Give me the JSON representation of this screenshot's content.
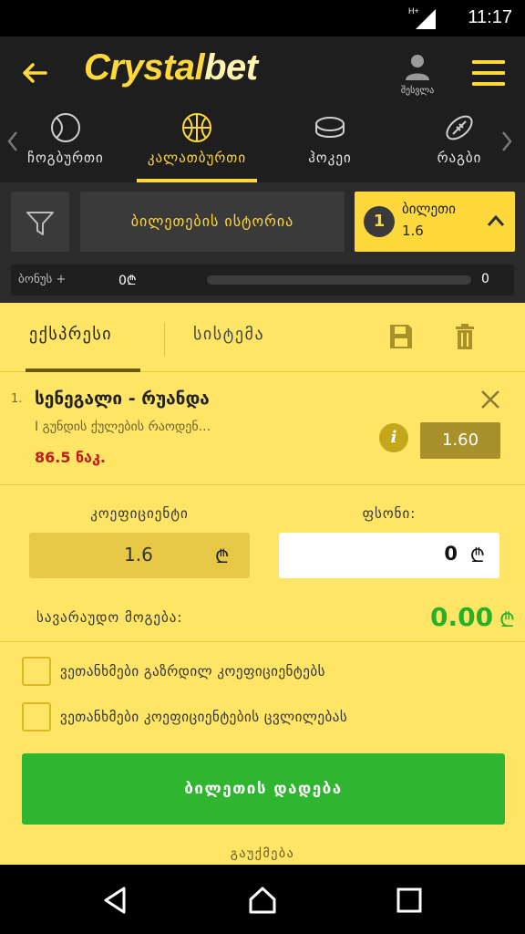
{
  "status": {
    "time": "11:17",
    "network": "H+"
  },
  "header": {
    "logo_main": "Crystal",
    "logo_accent": "bet",
    "user_label": "შესვლა"
  },
  "sports": [
    {
      "label": "ჩოგბურთი",
      "icon": "tennis-ball-icon"
    },
    {
      "label": "კალათბურთი",
      "icon": "basketball-icon",
      "active": true
    },
    {
      "label": "ჰოკეი",
      "icon": "hockey-puck-icon"
    },
    {
      "label": "რაგბი",
      "icon": "rugby-ball-icon"
    }
  ],
  "controls": {
    "history_label": "ბილეთების ისტორია",
    "ticket_count": "1",
    "ticket_label": "ბილეთი",
    "ticket_odds": "1.6"
  },
  "bonus": {
    "label": "ბონუს +",
    "current": "0₾",
    "max": "0",
    "progress": 0
  },
  "betslip": {
    "tabs": {
      "express": "ექსპრესი",
      "system": "სისტემა"
    },
    "selection": {
      "index": "1.",
      "match": "სენეგალი - რუანდა",
      "market": "I გუნდის ქულების რაოდენ...",
      "line": "86.5 ნაკ.",
      "odds": "1.60"
    },
    "coef_label": "კოეფიციენტი",
    "coef_value": "1.6",
    "stake_label": "ფსონი:",
    "stake_value": "0",
    "currency": "₾",
    "win_label": "სავარაუდო მოგება:",
    "win_value": "0.00",
    "check_increase": "ვეთანხმები გაზრდილ კოეფიციენტებს",
    "check_change": "ვეთანხმები კოეფიციენტების ცვლილებას",
    "place_label": "ბილეთის დადება",
    "cancel_label": "გაუქმება"
  },
  "colors": {
    "accent": "#ffd93b",
    "panel": "#ffe566",
    "win": "#27b027",
    "danger": "#c21a1a"
  }
}
